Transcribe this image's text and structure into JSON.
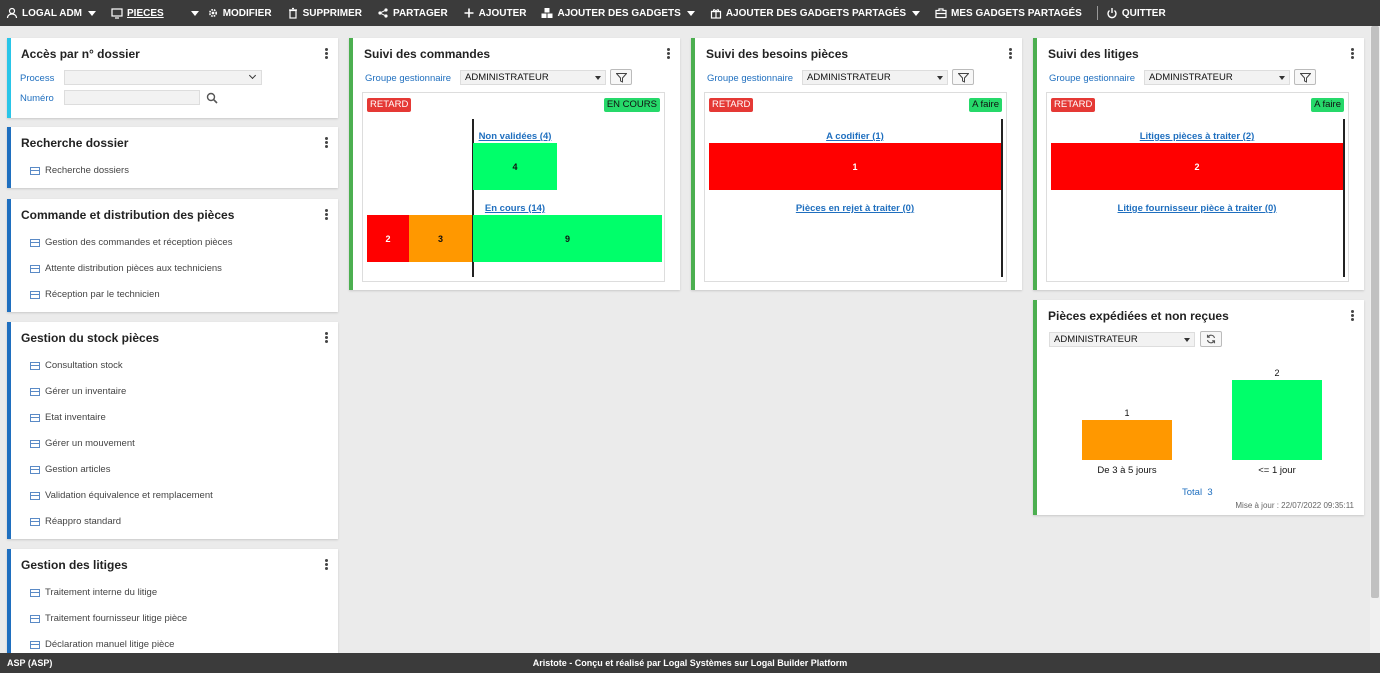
{
  "topbar": {
    "user_label": "LOGAL ADM",
    "module_label": "PIECES",
    "edit_label": "MODIFIER",
    "delete_label": "SUPPRIMER",
    "share_label": "PARTAGER",
    "add_label": "AJOUTER",
    "add_gadgets_label": "AJOUTER DES GADGETS",
    "add_shared_gadgets_label": "AJOUTER DES GADGETS PARTAGÉS",
    "my_shared_gadgets_label": "MES GADGETS PARTAGÉS",
    "quit_label": "QUITTER"
  },
  "acces": {
    "title": "Accès par n° dossier",
    "process_label": "Process",
    "process_value": "",
    "numero_label": "Numéro",
    "numero_value": ""
  },
  "recherche": {
    "title": "Recherche dossier",
    "items": [
      "Recherche dossiers"
    ]
  },
  "commande": {
    "title": "Commande et distribution des pièces",
    "items": [
      "Gestion des commandes et réception pièces",
      "Attente distribution pièces aux techniciens",
      "Réception par le technicien"
    ]
  },
  "stock": {
    "title": "Gestion du stock pièces",
    "items": [
      "Consultation stock",
      "Gérer un inventaire",
      "Etat inventaire",
      "Gérer un mouvement",
      "Gestion articles",
      "Validation équivalence et remplacement",
      "Réappro standard"
    ]
  },
  "litiges_menu": {
    "title": "Gestion des litiges",
    "items": [
      "Traitement interne du litige",
      "Traitement fournisseur litige pièce",
      "Déclaration manuel litige pièce"
    ]
  },
  "suivi_commandes": {
    "title": "Suivi des commandes",
    "group_label": "Groupe gestionnaire",
    "group_value": "ADMINISTRATEUR",
    "tag_left": "RETARD",
    "tag_right": "EN COURS",
    "row1_label": "Non validées (4)",
    "row2_label": "En cours (14)"
  },
  "suivi_besoins": {
    "title": "Suivi des besoins pièces",
    "group_label": "Groupe gestionnaire",
    "group_value": "ADMINISTRATEUR",
    "tag_left": "RETARD",
    "tag_right": "A faire",
    "row1_label": "A codifier (1)",
    "row2_label": "Pièces en rejet à traiter (0)"
  },
  "suivi_litiges": {
    "title": "Suivi des litiges",
    "group_label": "Groupe gestionnaire",
    "group_value": "ADMINISTRATEUR",
    "tag_left": "RETARD",
    "tag_right": "A faire",
    "row1_label": "Litiges pièces à traiter (2)",
    "row2_label": "Litige fournisseur pièce à traiter (0)"
  },
  "expediees": {
    "title": "Pièces expédiées et non reçues",
    "group_value": "ADMINISTRATEUR",
    "total_label": "Total",
    "total_value": "3",
    "updated": "Mise à jour : 22/07/2022 09:35:11"
  },
  "footer": {
    "left": "ASP (ASP)",
    "center": "Aristote - Conçu et réalisé par Logal Systèmes sur Logal Builder Platform"
  },
  "colors": {
    "late": "#ff0000",
    "warning": "#ff9800",
    "ok": "#00ff6a",
    "accent": "#1f6fbf"
  },
  "chart_data": [
    {
      "type": "bar",
      "orientation": "horizontal-stacked",
      "title": "Suivi des commandes",
      "categories": [
        "Non validées (4)",
        "En cours (14)"
      ],
      "series": [
        {
          "name": "RETARD",
          "values": [
            0,
            2
          ]
        },
        {
          "name": "RETARD",
          "values": [
            0,
            3
          ]
        },
        {
          "name": "EN COURS",
          "values": [
            4,
            9
          ]
        }
      ]
    },
    {
      "type": "bar",
      "orientation": "horizontal-stacked",
      "title": "Suivi des besoins pièces",
      "categories": [
        "A codifier (1)",
        "Pièces en rejet à traiter (0)"
      ],
      "series": [
        {
          "name": "RETARD",
          "values": [
            1,
            0
          ]
        },
        {
          "name": "A faire",
          "values": [
            0,
            0
          ]
        }
      ]
    },
    {
      "type": "bar",
      "orientation": "horizontal-stacked",
      "title": "Suivi des litiges",
      "categories": [
        "Litiges pièces à traiter (2)",
        "Litige fournisseur pièce à traiter (0)"
      ],
      "series": [
        {
          "name": "RETARD",
          "values": [
            2,
            0
          ]
        },
        {
          "name": "A faire",
          "values": [
            0,
            0
          ]
        }
      ]
    },
    {
      "type": "bar",
      "title": "Pièces expédiées et non reçues",
      "categories": [
        "De 3 à 5 jours",
        "<= 1 jour"
      ],
      "values": [
        1,
        2
      ],
      "colors": [
        "#ff9800",
        "#00ff6a"
      ]
    }
  ]
}
